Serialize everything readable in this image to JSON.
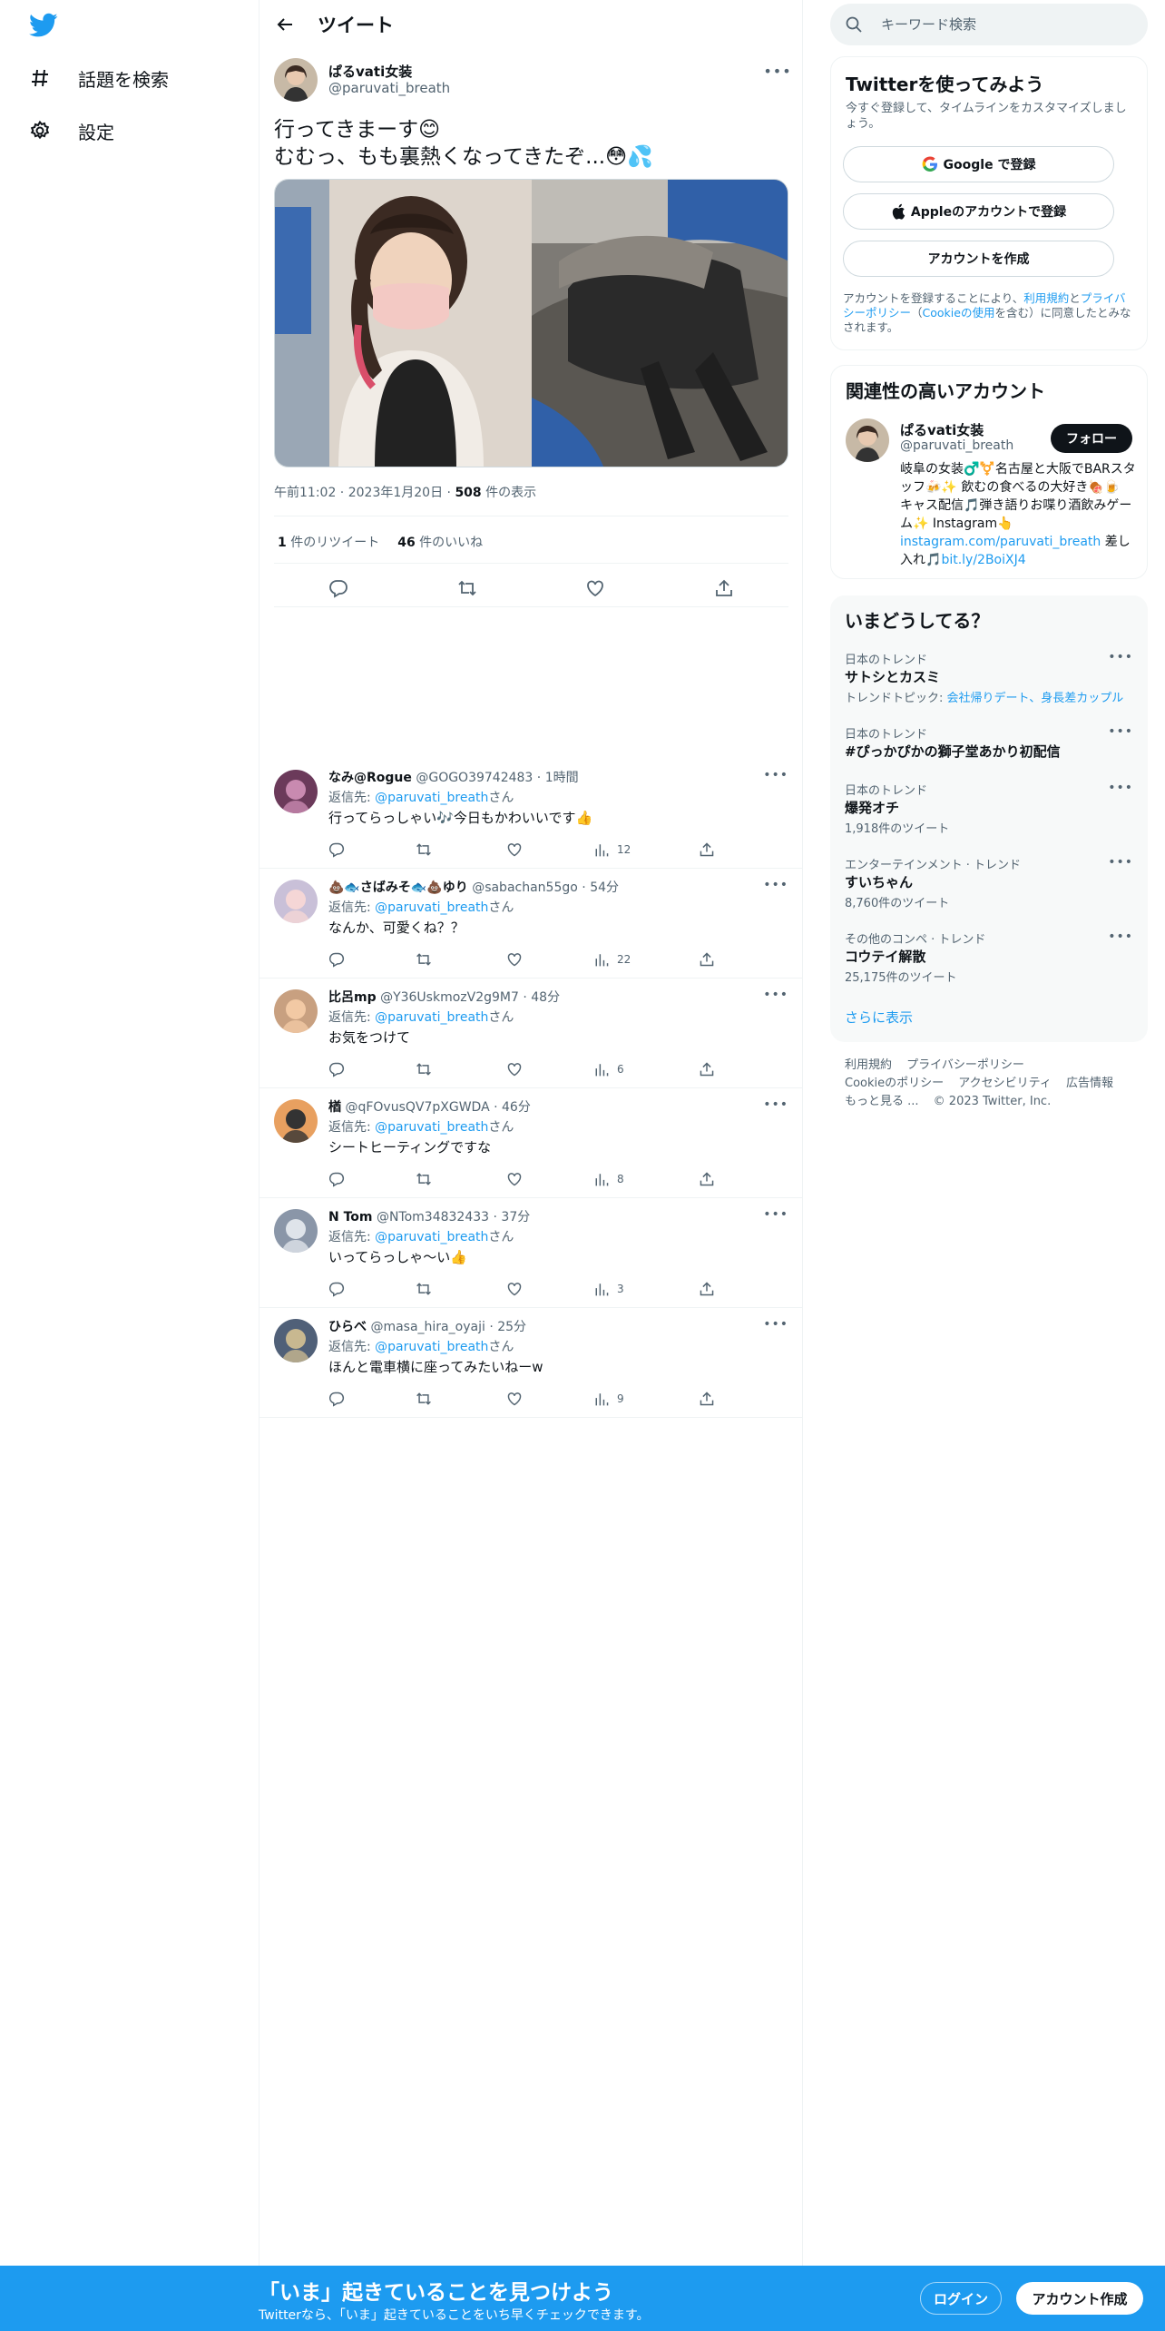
{
  "nav": {
    "explore_label": "話題を検索",
    "settings_label": "設定"
  },
  "header": {
    "title": "ツイート"
  },
  "tweet": {
    "name": "ぱるvati女装",
    "handle": "@paruvati_breath",
    "text_line1": "行ってきまーす😊",
    "text_line2": "むむっ、もも裏熱くなってきたぞ...😳💦",
    "time": "午前11:02",
    "date": "2023年1月20日",
    "views_count": "508",
    "views_label": "件の表示",
    "retweets_count": "1",
    "retweets_label": "件のリツイート",
    "likes_count": "46",
    "likes_label": "件のいいね"
  },
  "replies": [
    {
      "name": "なみ@Rogue",
      "handle": "@GOGO39742483",
      "time": "1時間",
      "reply_to_prefix": "返信先: ",
      "reply_to": "@paruvati_breath",
      "reply_to_suffix": "さん",
      "text": "行ってらっしゃい🎶今日もかわいいです👍",
      "views": "12"
    },
    {
      "name": "💩🐟さばみそ🐟💩ゆり",
      "handle": "@sabachan55go",
      "time": "54分",
      "reply_to_prefix": "返信先: ",
      "reply_to": "@paruvati_breath",
      "reply_to_suffix": "さん",
      "text": "なんか、可愛くね？？",
      "views": "22"
    },
    {
      "name": "比呂mp",
      "handle": "@Y36UskmozV2g9M7",
      "time": "48分",
      "reply_to_prefix": "返信先: ",
      "reply_to": "@paruvati_breath",
      "reply_to_suffix": "さん",
      "text": "お気をつけて",
      "views": "6"
    },
    {
      "name": "楢",
      "handle": "@qFOvusQV7pXGWDA",
      "time": "46分",
      "reply_to_prefix": "返信先: ",
      "reply_to": "@paruvati_breath",
      "reply_to_suffix": "さん",
      "text": "シートヒーティングですな",
      "views": "8"
    },
    {
      "name": "N Tom",
      "handle": "@NTom34832433",
      "time": "37分",
      "reply_to_prefix": "返信先: ",
      "reply_to": "@paruvati_breath",
      "reply_to_suffix": "さん",
      "text": "いってらっしゃ～い👍",
      "views": "3"
    },
    {
      "name": "ひらべ",
      "handle": "@masa_hira_oyaji",
      "time": "25分",
      "reply_to_prefix": "返信先: ",
      "reply_to": "@paruvati_breath",
      "reply_to_suffix": "さん",
      "text": "ほんと電車横に座ってみたいねーw",
      "views": "9"
    }
  ],
  "search": {
    "placeholder": "キーワード検索"
  },
  "signup": {
    "title": "Twitterを使ってみよう",
    "subtitle": "今すぐ登録して、タイムラインをカスタマイズしましょう。",
    "google_label": "Google で登録",
    "apple_label": "Appleのアカウントで登録",
    "create_label": "アカウントを作成",
    "legal_1": "アカウントを登録することにより、",
    "legal_terms": "利用規約",
    "legal_2": "と",
    "legal_privacy": "プライバシーポリシー",
    "legal_3": "（",
    "legal_cookie": "Cookieの使用",
    "legal_4": "を含む）に同意したとみなされます。"
  },
  "related": {
    "title": "関連性の高いアカウント",
    "name": "ぱるvati女装",
    "handle": "@paruvati_breath",
    "follow_label": "フォロー",
    "bio": "岐阜の女装♂️⚧️名古屋と大阪でBARスタッフ🍻✨ 飲むの食べるの大好き🍖🍺 キャス配信🎵弾き語りお喋り酒飲みゲーム✨ Instagram👆",
    "bio_link1": "instagram.com/paruvati_breath",
    "bio_mid": " 差し入れ🎵",
    "bio_link2": "bit.ly/2BoiXJ4"
  },
  "trends": {
    "title": "いまどうしてる？",
    "items": [
      {
        "context": "日本のトレンド",
        "title": "サトシとカスミ",
        "sub_prefix": "トレンドトピック: ",
        "sub_links": "会社帰りデート、身長差カップル"
      },
      {
        "context": "日本のトレンド",
        "title": "#ぴっかぴかの獅子堂あかり初配信",
        "sub": ""
      },
      {
        "context": "日本のトレンド",
        "title": "爆発オチ",
        "sub": "1,918件のツイート"
      },
      {
        "context": "エンターテインメント · トレンド",
        "title": "すいちゃん",
        "sub": "8,760件のツイート"
      },
      {
        "context": "その他のコンペ · トレンド",
        "title": "コウテイ解散",
        "sub": "25,175件のツイート"
      }
    ],
    "show_more": "さらに表示"
  },
  "footer": {
    "terms": "利用規約",
    "privacy": "プライバシーポリシー",
    "cookie": "Cookieのポリシー",
    "accessibility": "アクセシビリティ",
    "ads": "広告情報",
    "more": "もっと見る ...",
    "copyright": "© 2023 Twitter, Inc."
  },
  "bottombar": {
    "title": "「いま」起きていることを見つけよう",
    "subtitle": "Twitterなら、「いま」起きていることをいち早くチェックできます。",
    "login_label": "ログイン",
    "signup_label": "アカウント作成"
  },
  "colors": {
    "accent": "#1d9bf0",
    "text": "#0f1419",
    "muted": "#536471"
  }
}
